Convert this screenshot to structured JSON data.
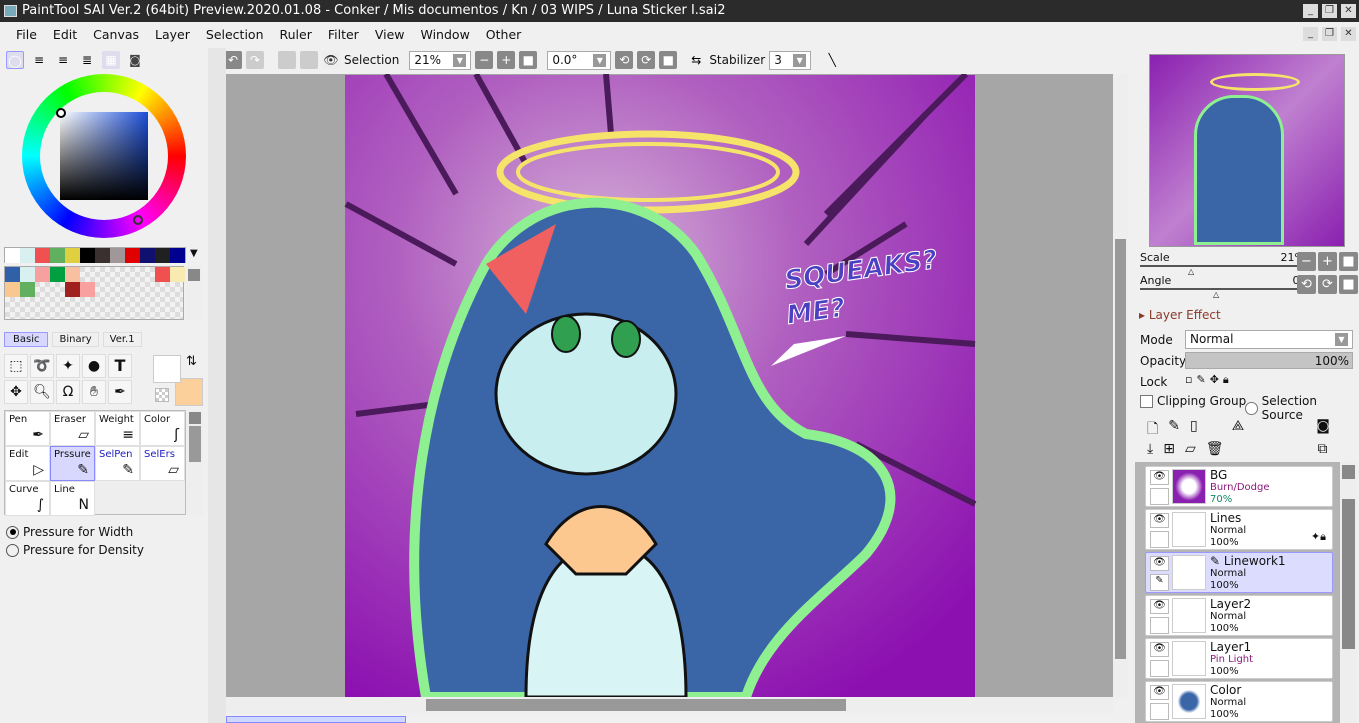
{
  "window": {
    "title": "PaintTool SAI Ver.2 (64bit) Preview.2020.01.08 - Conker / Mis documentos / Kn / 03 WIPS / Luna Sticker I.sai2"
  },
  "menu": [
    "File",
    "Edit",
    "Canvas",
    "Layer",
    "Selection",
    "Ruler",
    "Filter",
    "View",
    "Window",
    "Other"
  ],
  "toolbar": {
    "selection_label": "Selection",
    "zoom": "21%",
    "angle": "0.0°",
    "stabilizer_label": "Stabilizer",
    "stabilizer": "3"
  },
  "palette": {
    "top": [
      "#ffffff",
      "#d8f0f0",
      "#f05050",
      "#60b060",
      "#e0d040",
      "#000000",
      "#3a3030",
      "#a09898",
      "#e00000",
      "#101070",
      "#202020",
      "#000090"
    ],
    "grid": [
      "#3060a8",
      "#d8f0f0",
      "#f8a0a0",
      "#00a040",
      "#f8c0a0",
      "",
      "",
      "",
      "",
      "",
      "#f05050",
      "#f8eab0",
      "#f8c890",
      "#60b060",
      "",
      "",
      "#a02020",
      "#f8a0a0"
    ]
  },
  "tool_tabs": [
    "Basic",
    "Binary",
    "Ver.1"
  ],
  "colors": {
    "primary": "#ffffff",
    "secondary": "#fcd09a"
  },
  "brushes": [
    {
      "name": "Pen",
      "icon": "pen-icon",
      "glyph": "✒"
    },
    {
      "name": "Eraser",
      "icon": "eraser-icon",
      "glyph": "▱"
    },
    {
      "name": "Weight",
      "icon": "weight-icon",
      "glyph": "≡"
    },
    {
      "name": "Color",
      "icon": "color-icon",
      "glyph": "ʃ"
    },
    {
      "name": "Edit",
      "icon": "edit-icon",
      "glyph": "▷"
    },
    {
      "name": "Prssure",
      "icon": "pressure-icon",
      "glyph": "✎"
    },
    {
      "name": "SelPen",
      "icon": "selpen-icon",
      "glyph": "✎"
    },
    {
      "name": "SelErs",
      "icon": "selers-icon",
      "glyph": "▱"
    },
    {
      "name": "Curve",
      "icon": "curve-icon",
      "glyph": "∫"
    },
    {
      "name": "Line",
      "icon": "line-icon",
      "glyph": "N"
    }
  ],
  "pressure": {
    "width": "Pressure for Width",
    "density": "Pressure for Density"
  },
  "artwork": {
    "line1": "SQUEAKS?",
    "line2": "ME?"
  },
  "navigator": {
    "scale_label": "Scale",
    "scale": "21%",
    "angle_label": "Angle",
    "angle": "0°"
  },
  "layer_panel": {
    "effect": "Layer Effect",
    "mode_label": "Mode",
    "mode": "Normal",
    "opacity_label": "Opacity",
    "opacity": "100%",
    "opacity_value": 100,
    "lock_label": "Lock",
    "clipping": "Clipping Group",
    "selection_source": "Selection Source"
  },
  "layers": [
    {
      "name": "BG",
      "mode": "Burn/Dodge",
      "opacity": "70%",
      "mode_color": "#8a1a7a",
      "op_color": "#118866"
    },
    {
      "name": "Lines",
      "mode": "Normal",
      "opacity": "100%"
    },
    {
      "name": "Linework1",
      "mode": "Normal",
      "opacity": "100%",
      "selected": true
    },
    {
      "name": "Layer2",
      "mode": "Normal",
      "opacity": "100%"
    },
    {
      "name": "Layer1",
      "mode": "Pin Light",
      "opacity": "100%",
      "mode_color": "#8a1a7a"
    },
    {
      "name": "Color",
      "mode": "Normal",
      "opacity": "100%"
    }
  ]
}
